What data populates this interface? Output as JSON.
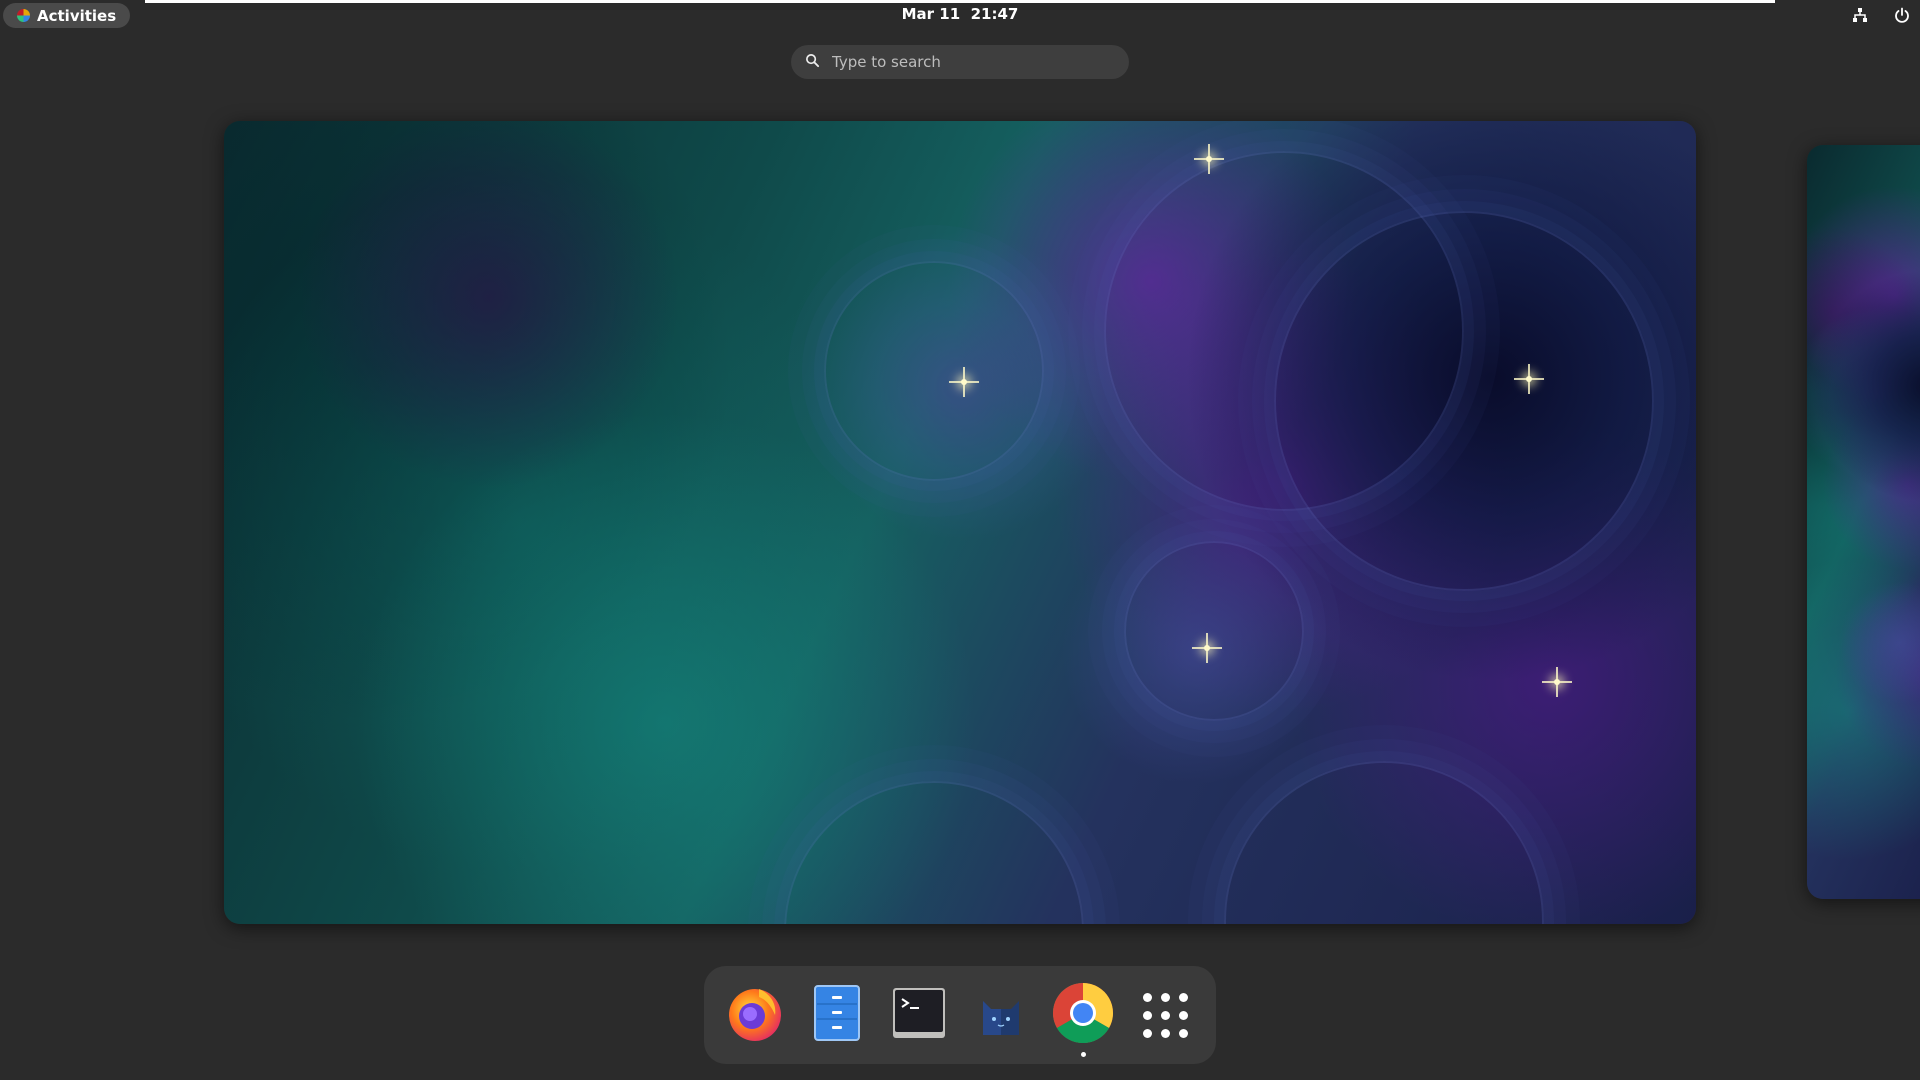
{
  "topbar": {
    "activities_label": "Activities",
    "clock": "Mar 11  21:47",
    "tray_icons": [
      "network-wired-icon",
      "power-icon"
    ]
  },
  "search": {
    "placeholder": "Type to search"
  },
  "dock": {
    "apps": [
      {
        "name": "Firefox",
        "icon": "firefox-icon",
        "running": false
      },
      {
        "name": "Files",
        "icon": "files-icon",
        "running": false
      },
      {
        "name": "Terminal",
        "icon": "terminal-icon",
        "running": false
      },
      {
        "name": "Cat App",
        "icon": "cat-app-icon",
        "running": false
      },
      {
        "name": "Google Chrome",
        "icon": "chrome-icon",
        "running": true
      },
      {
        "name": "Show Applications",
        "icon": "apps-grid-icon",
        "running": false
      }
    ]
  },
  "colors": {
    "panel_bg": "#2b2b2b",
    "dock_bg": "#3a3a3a",
    "search_bg": "#3e3e3e",
    "activities_bg": "#4a4a4a"
  }
}
